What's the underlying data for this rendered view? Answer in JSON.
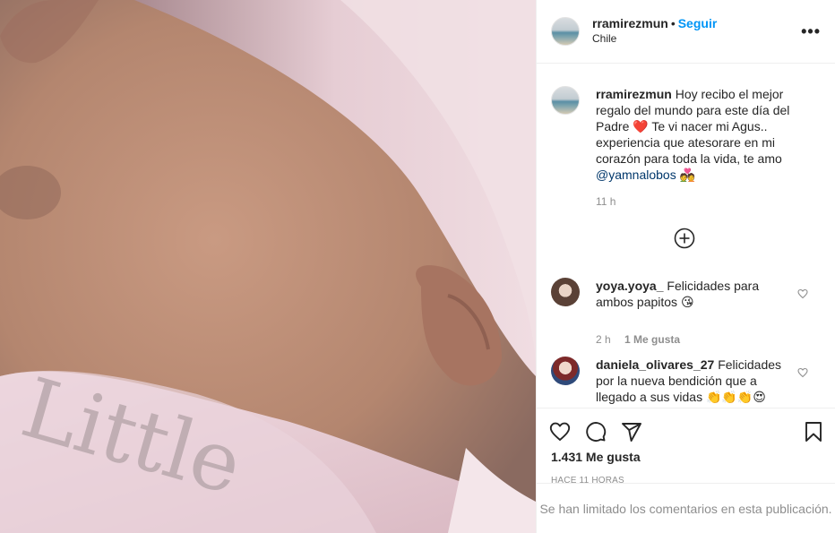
{
  "post": {
    "username": "rramirezmun",
    "separator": "•",
    "follow_label": "Seguir",
    "location": "Chile",
    "more_label": "•••",
    "caption": {
      "username": "rramirezmun",
      "text_1": "Hoy recibo el mejor regalo del mundo para este día del Padre",
      "emoji_heart": "❤️",
      "text_2": "Te vi nacer mi Agus.. experiencia que atesorare en mi corazón para toda la vida, te amo",
      "mention": "@yamnalobos",
      "emoji_couple": "💑",
      "time": "11 h"
    },
    "comments": [
      {
        "username": "yoya.yoya_",
        "text": "Felicidades para ambos papitos",
        "emoji": "😘",
        "time": "2 h",
        "likes": "1 Me gusta"
      },
      {
        "username": "daniela_olivares_27",
        "text": "Felicidades por la nueva bendición que a llegado a sus vidas",
        "emoji": "👏👏👏😍"
      }
    ],
    "likes_count": "1.431 Me gusta",
    "posted_ago": "HACE 11 HORAS",
    "comments_limited": "Se han limitado los comentarios en esta publicación.",
    "photo_text": "Little"
  },
  "colors": {
    "accent": "#0095f6",
    "mention": "#00376b",
    "muted": "#8e8e8e",
    "border": "#efefef",
    "heart_red": "#ed4956"
  }
}
